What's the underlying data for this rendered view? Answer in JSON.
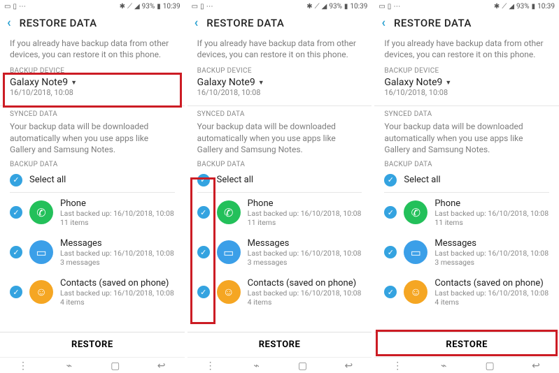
{
  "status": {
    "battery": "93%",
    "time": "10:39"
  },
  "header": {
    "title": "RESTORE DATA"
  },
  "intro": "If you already have backup data from other devices, you can restore it on this phone.",
  "backup_device": {
    "label": "BACKUP DEVICE",
    "name": "Galaxy Note9",
    "timestamp": "16/10/2018, 10:08"
  },
  "synced": {
    "label": "SYNCED DATA",
    "text": "Your backup data will be downloaded automatically when you use apps like Gallery and Samsung Notes."
  },
  "backup_list_label": "BACKUP DATA",
  "select_all": "Select all",
  "items": [
    {
      "title": "Phone",
      "sub1": "Last backed up: 16/10/2018, 10:08",
      "sub2": "11 items"
    },
    {
      "title": "Messages",
      "sub1": "Last backed up: 16/10/2018, 10:08",
      "sub2": "3 messages"
    },
    {
      "title": "Contacts (saved on phone)",
      "sub1": "Last backed up: 16/10/2018, 10:08",
      "sub2": "4 items"
    }
  ],
  "restore_btn": "RESTORE"
}
